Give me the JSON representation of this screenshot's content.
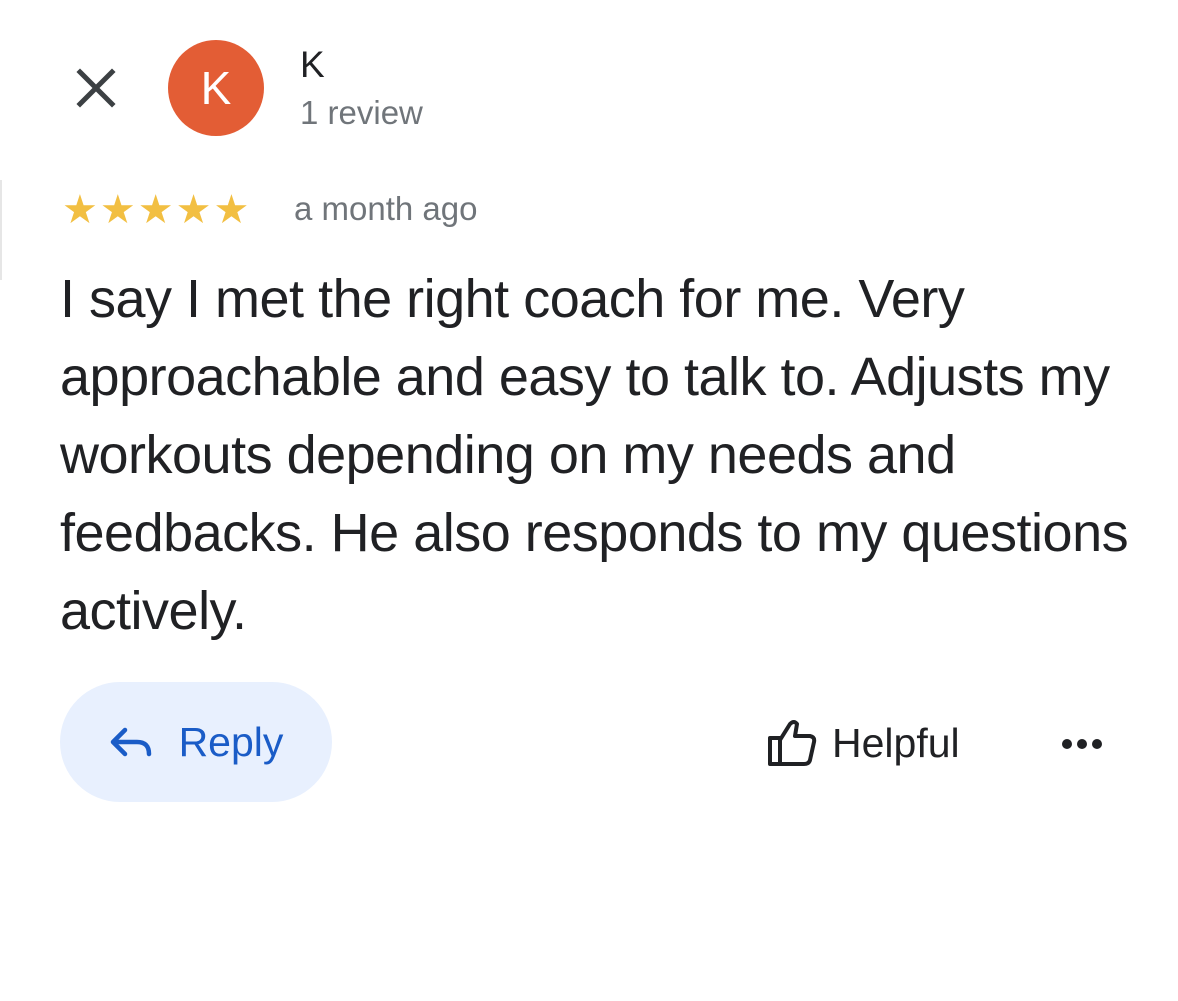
{
  "review": {
    "author": {
      "initial": "K",
      "name": "K",
      "meta": "1 review"
    },
    "rating": 5,
    "rating_max": 5,
    "time": "a month ago",
    "text": "I say I met the right coach for me. Very approachable and easy to talk to. Adjusts my workouts depending on my needs and feedbacks. He also responds to my questions actively."
  },
  "actions": {
    "reply_label": "Reply",
    "helpful_label": "Helpful"
  },
  "icons": {
    "close": "close-icon",
    "reply": "reply-arrow-icon",
    "helpful": "thumbs-up-outline-icon",
    "more": "more-horizontal-icon",
    "star": "star-icon"
  },
  "colors": {
    "avatar_bg": "#e35d35",
    "star": "#f2bf42",
    "accent": "#1a5cc7",
    "reply_bg": "#e8f0fe",
    "text_primary": "#202124",
    "text_secondary": "#70757a"
  }
}
